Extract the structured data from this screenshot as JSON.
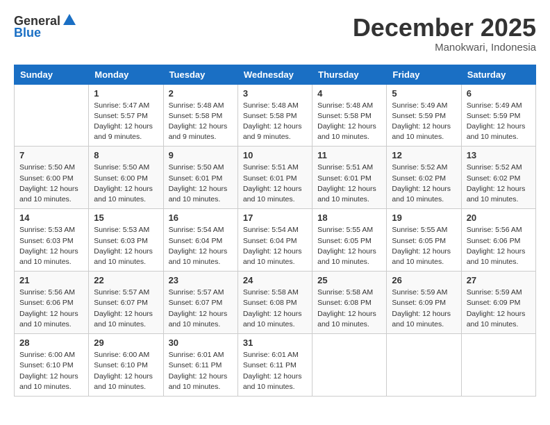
{
  "logo": {
    "general": "General",
    "blue": "Blue"
  },
  "header": {
    "month": "December 2025",
    "location": "Manokwari, Indonesia"
  },
  "weekdays": [
    "Sunday",
    "Monday",
    "Tuesday",
    "Wednesday",
    "Thursday",
    "Friday",
    "Saturday"
  ],
  "weeks": [
    [
      {
        "day": "",
        "info": ""
      },
      {
        "day": "1",
        "info": "Sunrise: 5:47 AM\nSunset: 5:57 PM\nDaylight: 12 hours\nand 9 minutes."
      },
      {
        "day": "2",
        "info": "Sunrise: 5:48 AM\nSunset: 5:58 PM\nDaylight: 12 hours\nand 9 minutes."
      },
      {
        "day": "3",
        "info": "Sunrise: 5:48 AM\nSunset: 5:58 PM\nDaylight: 12 hours\nand 9 minutes."
      },
      {
        "day": "4",
        "info": "Sunrise: 5:48 AM\nSunset: 5:58 PM\nDaylight: 12 hours\nand 10 minutes."
      },
      {
        "day": "5",
        "info": "Sunrise: 5:49 AM\nSunset: 5:59 PM\nDaylight: 12 hours\nand 10 minutes."
      },
      {
        "day": "6",
        "info": "Sunrise: 5:49 AM\nSunset: 5:59 PM\nDaylight: 12 hours\nand 10 minutes."
      }
    ],
    [
      {
        "day": "7",
        "info": "Sunrise: 5:50 AM\nSunset: 6:00 PM\nDaylight: 12 hours\nand 10 minutes."
      },
      {
        "day": "8",
        "info": "Sunrise: 5:50 AM\nSunset: 6:00 PM\nDaylight: 12 hours\nand 10 minutes."
      },
      {
        "day": "9",
        "info": "Sunrise: 5:50 AM\nSunset: 6:01 PM\nDaylight: 12 hours\nand 10 minutes."
      },
      {
        "day": "10",
        "info": "Sunrise: 5:51 AM\nSunset: 6:01 PM\nDaylight: 12 hours\nand 10 minutes."
      },
      {
        "day": "11",
        "info": "Sunrise: 5:51 AM\nSunset: 6:01 PM\nDaylight: 12 hours\nand 10 minutes."
      },
      {
        "day": "12",
        "info": "Sunrise: 5:52 AM\nSunset: 6:02 PM\nDaylight: 12 hours\nand 10 minutes."
      },
      {
        "day": "13",
        "info": "Sunrise: 5:52 AM\nSunset: 6:02 PM\nDaylight: 12 hours\nand 10 minutes."
      }
    ],
    [
      {
        "day": "14",
        "info": "Sunrise: 5:53 AM\nSunset: 6:03 PM\nDaylight: 12 hours\nand 10 minutes."
      },
      {
        "day": "15",
        "info": "Sunrise: 5:53 AM\nSunset: 6:03 PM\nDaylight: 12 hours\nand 10 minutes."
      },
      {
        "day": "16",
        "info": "Sunrise: 5:54 AM\nSunset: 6:04 PM\nDaylight: 12 hours\nand 10 minutes."
      },
      {
        "day": "17",
        "info": "Sunrise: 5:54 AM\nSunset: 6:04 PM\nDaylight: 12 hours\nand 10 minutes."
      },
      {
        "day": "18",
        "info": "Sunrise: 5:55 AM\nSunset: 6:05 PM\nDaylight: 12 hours\nand 10 minutes."
      },
      {
        "day": "19",
        "info": "Sunrise: 5:55 AM\nSunset: 6:05 PM\nDaylight: 12 hours\nand 10 minutes."
      },
      {
        "day": "20",
        "info": "Sunrise: 5:56 AM\nSunset: 6:06 PM\nDaylight: 12 hours\nand 10 minutes."
      }
    ],
    [
      {
        "day": "21",
        "info": "Sunrise: 5:56 AM\nSunset: 6:06 PM\nDaylight: 12 hours\nand 10 minutes."
      },
      {
        "day": "22",
        "info": "Sunrise: 5:57 AM\nSunset: 6:07 PM\nDaylight: 12 hours\nand 10 minutes."
      },
      {
        "day": "23",
        "info": "Sunrise: 5:57 AM\nSunset: 6:07 PM\nDaylight: 12 hours\nand 10 minutes."
      },
      {
        "day": "24",
        "info": "Sunrise: 5:58 AM\nSunset: 6:08 PM\nDaylight: 12 hours\nand 10 minutes."
      },
      {
        "day": "25",
        "info": "Sunrise: 5:58 AM\nSunset: 6:08 PM\nDaylight: 12 hours\nand 10 minutes."
      },
      {
        "day": "26",
        "info": "Sunrise: 5:59 AM\nSunset: 6:09 PM\nDaylight: 12 hours\nand 10 minutes."
      },
      {
        "day": "27",
        "info": "Sunrise: 5:59 AM\nSunset: 6:09 PM\nDaylight: 12 hours\nand 10 minutes."
      }
    ],
    [
      {
        "day": "28",
        "info": "Sunrise: 6:00 AM\nSunset: 6:10 PM\nDaylight: 12 hours\nand 10 minutes."
      },
      {
        "day": "29",
        "info": "Sunrise: 6:00 AM\nSunset: 6:10 PM\nDaylight: 12 hours\nand 10 minutes."
      },
      {
        "day": "30",
        "info": "Sunrise: 6:01 AM\nSunset: 6:11 PM\nDaylight: 12 hours\nand 10 minutes."
      },
      {
        "day": "31",
        "info": "Sunrise: 6:01 AM\nSunset: 6:11 PM\nDaylight: 12 hours\nand 10 minutes."
      },
      {
        "day": "",
        "info": ""
      },
      {
        "day": "",
        "info": ""
      },
      {
        "day": "",
        "info": ""
      }
    ]
  ]
}
